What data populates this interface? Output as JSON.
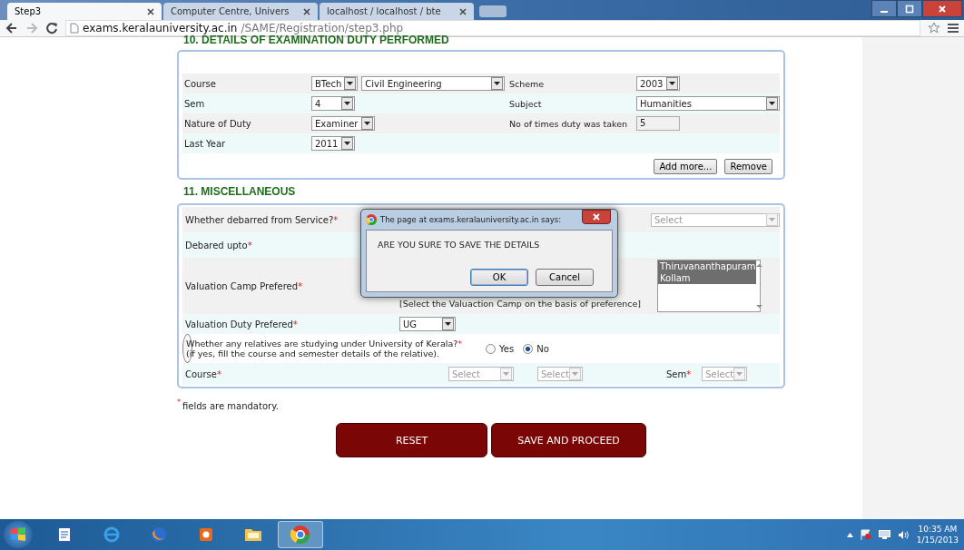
{
  "browser": {
    "tabs": [
      {
        "label": "Step3",
        "selected": true
      },
      {
        "label": "Computer Centre, Univers",
        "selected": false
      },
      {
        "label": "localhost / localhost / bte",
        "selected": false
      }
    ],
    "address": {
      "host": "exams.keralauniversity.ac.in",
      "path": "/SAME/Registration/step3.php"
    }
  },
  "section10": {
    "title": "10. DETAILS OF EXAMINATION DUTY PERFORMED",
    "rows": [
      {
        "label": "Course",
        "controls": [
          {
            "kind": "select",
            "value": "BTech"
          },
          {
            "kind": "select",
            "value": "Civil Engineering"
          }
        ],
        "label2": "Scheme",
        "controls2": [
          {
            "kind": "select",
            "value": "2003"
          }
        ]
      },
      {
        "label": "Sem",
        "controls": [
          {
            "kind": "select",
            "value": "4"
          }
        ],
        "label2": "Subject",
        "controls2": [
          {
            "kind": "select",
            "value": "Humanities"
          }
        ]
      },
      {
        "label": "Nature of Duty",
        "controls": [
          {
            "kind": "select",
            "value": "Examiner"
          }
        ],
        "label2": "No of times duty was taken",
        "controls2": [
          {
            "kind": "input",
            "value": "5"
          }
        ]
      },
      {
        "label": "Last Year",
        "controls": [
          {
            "kind": "select",
            "value": "2011"
          }
        ]
      }
    ],
    "buttons": [
      "Add more...",
      "Remove"
    ]
  },
  "section11": {
    "title": "11. MISCELLANEOUS",
    "rows": [
      {
        "kind": "select",
        "label": "Whether debarred from Service?",
        "mark": "*",
        "select": {
          "value": "Select",
          "disabled": true
        }
      },
      {
        "kind": "plain",
        "label": "Debared upto",
        "mark": "*"
      },
      {
        "kind": "camp",
        "label": "Valuation Camp Prefered",
        "mark": "*",
        "hint": "[Select the Valuaction Camp on the basis of preference]",
        "options": [
          {
            "label": "Thiruvananthapuram",
            "selected": true
          },
          {
            "label": "Kollam",
            "selected": true
          }
        ]
      },
      {
        "kind": "duty",
        "label": "Valuation Duty Prefered",
        "mark": "*",
        "select": {
          "value": "UG",
          "disabled": false
        }
      },
      {
        "kind": "radio",
        "label": "Whether any relatives are studying under University of Kerala?",
        "mark": "*",
        "note": "(if yes, fill the course and semester details of the relative).",
        "options": [
          {
            "label": "Yes",
            "selected": false
          },
          {
            "label": "No",
            "selected": true
          }
        ]
      },
      {
        "kind": "course",
        "label": "Course",
        "mark": "*",
        "selects": [
          {
            "value": "Select",
            "disabled": true
          },
          {
            "value": "Select",
            "disabled": true
          }
        ],
        "label2": "Sem",
        "mark2": "*",
        "select2": {
          "value": "Select",
          "disabled": true
        }
      }
    ]
  },
  "mandatory": {
    "mark": "*",
    "text": "fields are mandatory."
  },
  "buttons": [
    "RESET",
    "SAVE AND PROCEED"
  ],
  "dialog": {
    "title": "The page at exams.keralauniversity.ac.in says:",
    "message": "ARE YOU SURE TO SAVE THE DETAILS",
    "buttons": [
      {
        "label": "OK",
        "selected": true
      },
      {
        "label": "Cancel",
        "selected": false
      }
    ]
  },
  "taskbar": {
    "time": "10:35 AM",
    "date": "1/15/2013"
  }
}
